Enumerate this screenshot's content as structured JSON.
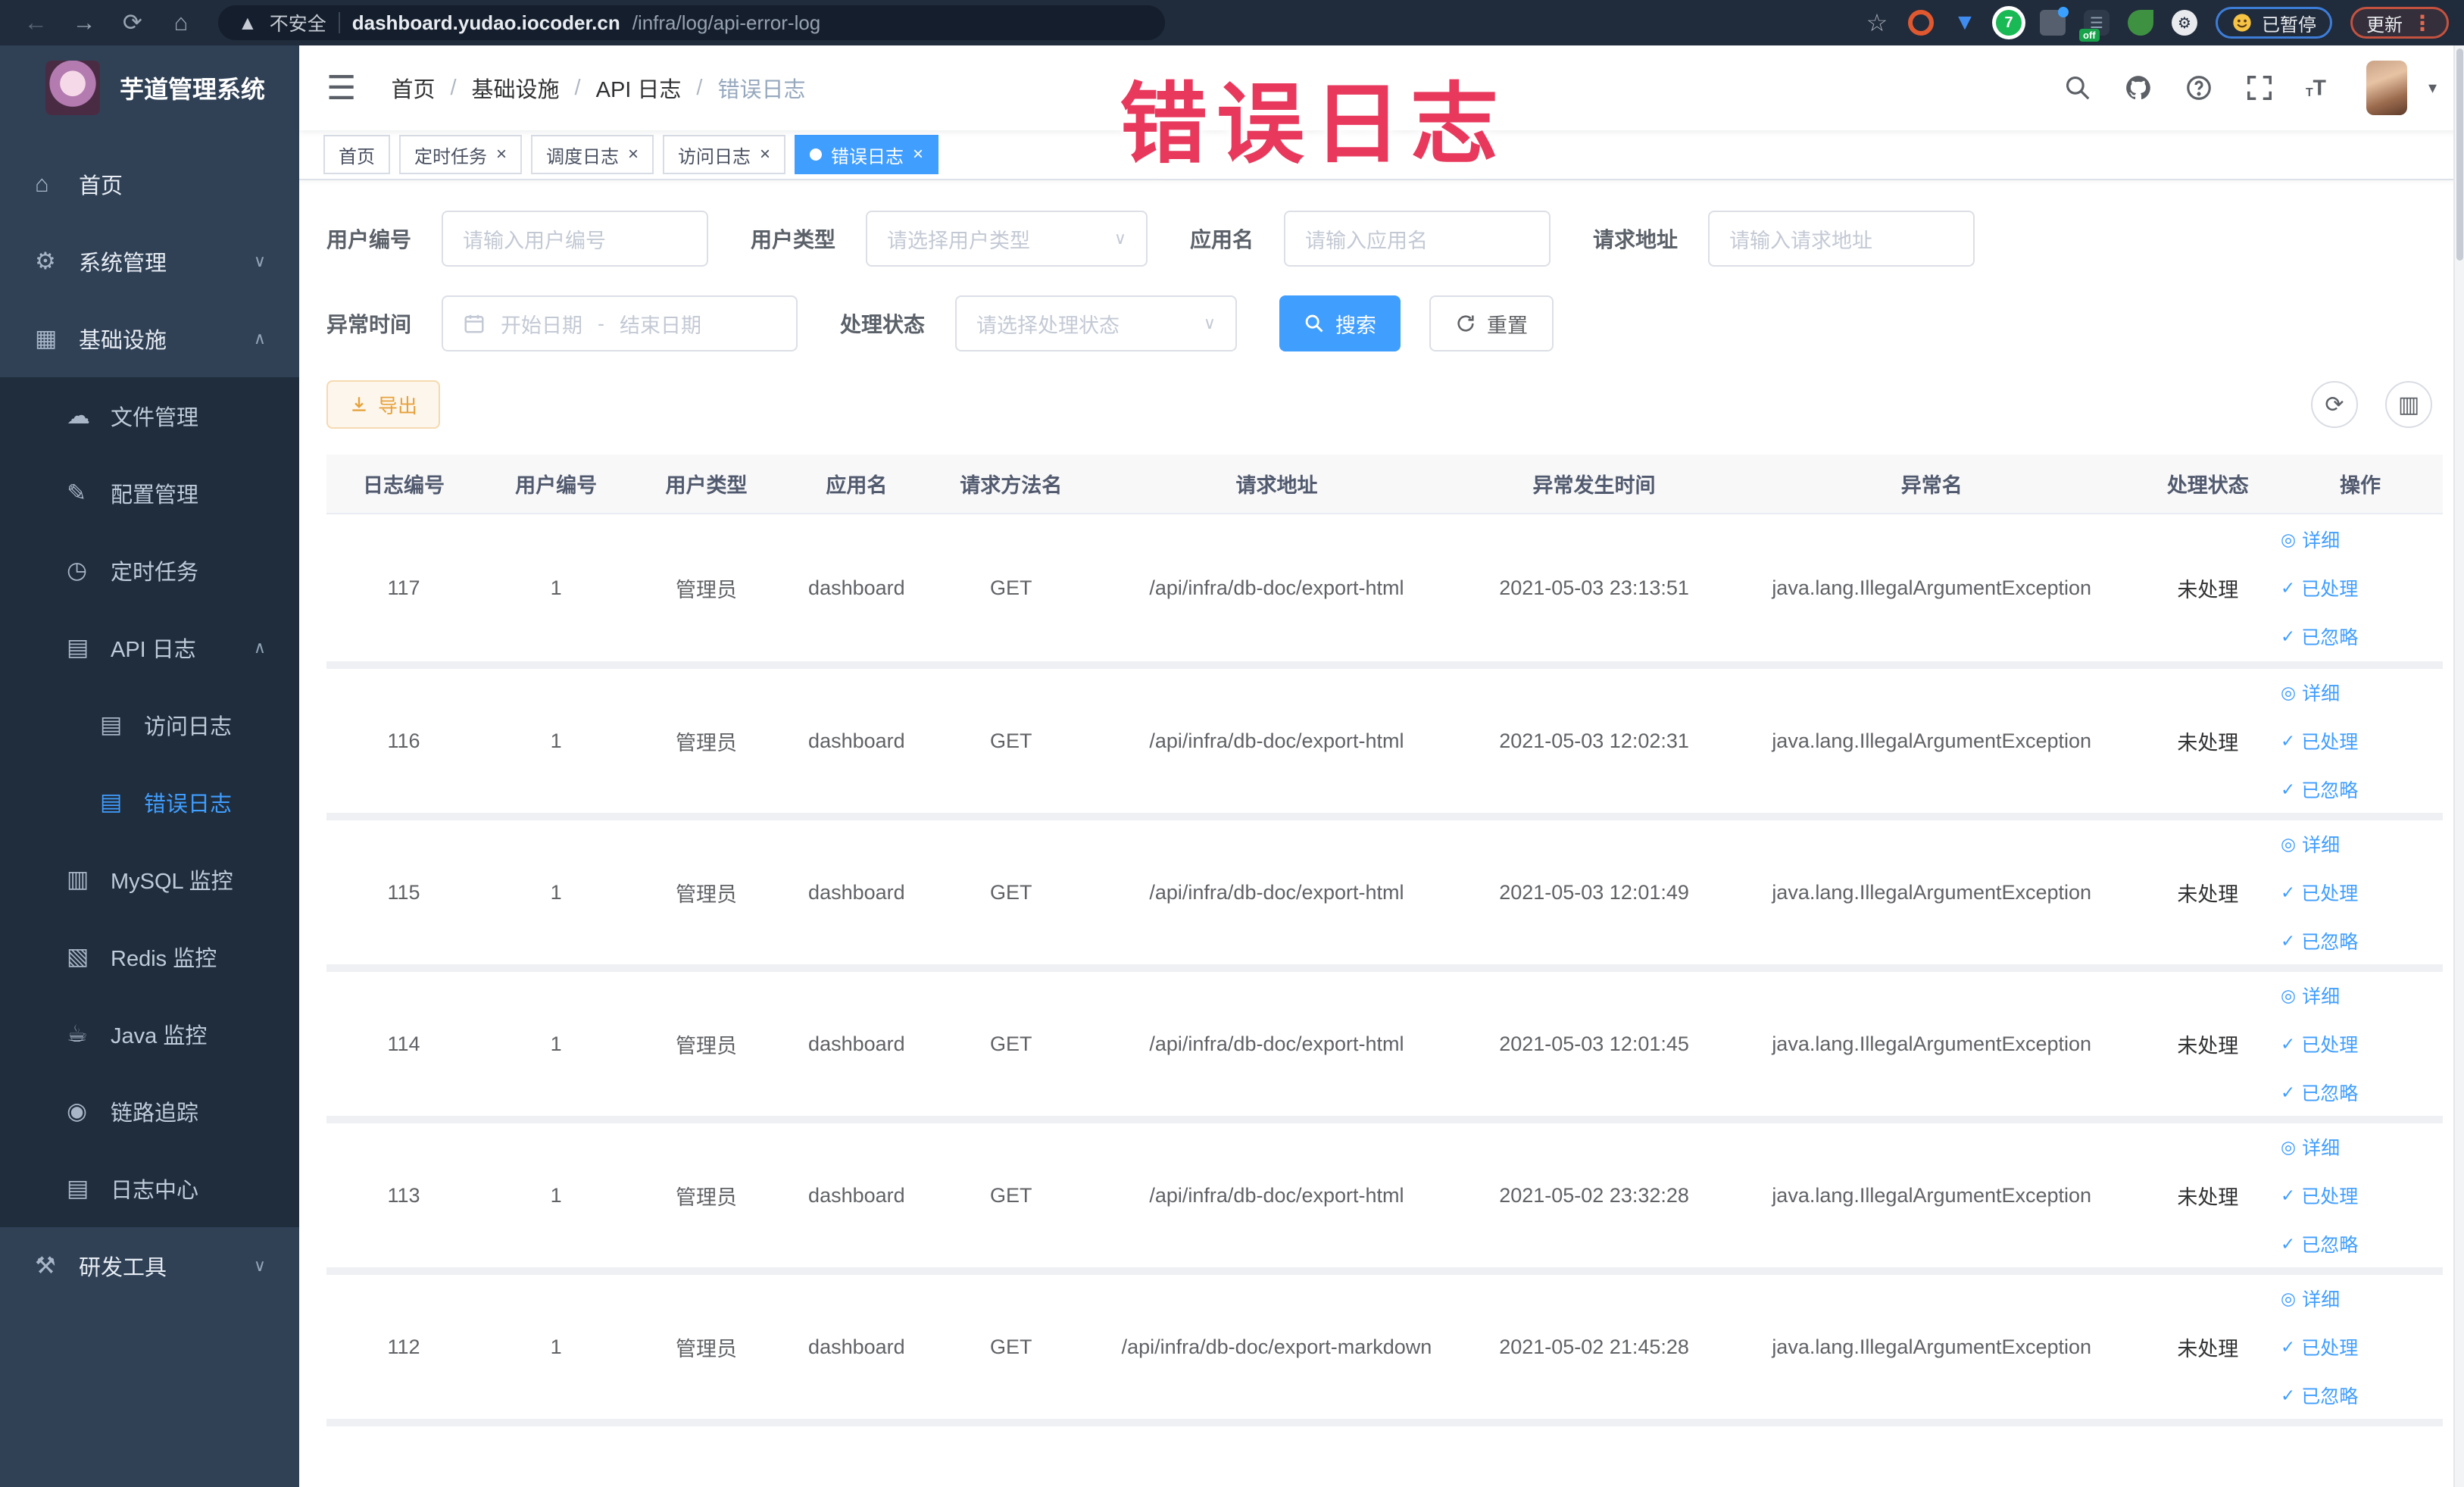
{
  "browser": {
    "security_label": "不安全",
    "url_host": "dashboard.yudao.iocoder.cn",
    "url_path": "/infra/log/api-error-log",
    "paused_badge": "已暂停",
    "update_button": "更新",
    "extension_badge_off": "off",
    "extension_badge_7": "7"
  },
  "watermark": "错误日志",
  "sidebar": {
    "title": "芋道管理系统",
    "items": [
      {
        "label": "首页",
        "level": 1,
        "icon": "home",
        "arrow": null,
        "active": false
      },
      {
        "label": "系统管理",
        "level": 1,
        "icon": "gear",
        "arrow": "down",
        "active": false
      },
      {
        "label": "基础设施",
        "level": 1,
        "icon": "infra",
        "arrow": "up",
        "active": false
      },
      {
        "label": "文件管理",
        "level": 2,
        "icon": "file",
        "arrow": null,
        "active": false
      },
      {
        "label": "配置管理",
        "level": 2,
        "icon": "edit",
        "arrow": null,
        "active": false
      },
      {
        "label": "定时任务",
        "level": 2,
        "icon": "timer",
        "arrow": null,
        "active": false
      },
      {
        "label": "API 日志",
        "level": 2,
        "icon": "log",
        "arrow": "up",
        "active": false
      },
      {
        "label": "访问日志",
        "level": 3,
        "icon": "log",
        "arrow": null,
        "active": false
      },
      {
        "label": "错误日志",
        "level": 3,
        "icon": "log",
        "arrow": null,
        "active": true
      },
      {
        "label": "MySQL 监控",
        "level": 2,
        "icon": "mysql",
        "arrow": null,
        "active": false
      },
      {
        "label": "Redis 监控",
        "level": 2,
        "icon": "redis",
        "arrow": null,
        "active": false
      },
      {
        "label": "Java 监控",
        "level": 2,
        "icon": "java",
        "arrow": null,
        "active": false
      },
      {
        "label": "链路追踪",
        "level": 2,
        "icon": "trace",
        "arrow": null,
        "active": false
      },
      {
        "label": "日志中心",
        "level": 2,
        "icon": "logcenter",
        "arrow": null,
        "active": false
      },
      {
        "label": "研发工具",
        "level": 1,
        "icon": "tool",
        "arrow": "down",
        "active": false
      }
    ]
  },
  "breadcrumb": [
    "首页",
    "基础设施",
    "API 日志",
    "错误日志"
  ],
  "tabs": [
    {
      "label": "首页",
      "closable": false,
      "active": false
    },
    {
      "label": "定时任务",
      "closable": true,
      "active": false
    },
    {
      "label": "调度日志",
      "closable": true,
      "active": false
    },
    {
      "label": "访问日志",
      "closable": true,
      "active": false
    },
    {
      "label": "错误日志",
      "closable": true,
      "active": true
    }
  ],
  "filters": {
    "user_id": {
      "label": "用户编号",
      "placeholder": "请输入用户编号"
    },
    "user_type": {
      "label": "用户类型",
      "placeholder": "请选择用户类型"
    },
    "app_name": {
      "label": "应用名",
      "placeholder": "请输入应用名"
    },
    "request_url": {
      "label": "请求地址",
      "placeholder": "请输入请求地址"
    },
    "exception_time": {
      "label": "异常时间",
      "start_placeholder": "开始日期",
      "separator": "-",
      "end_placeholder": "结束日期"
    },
    "process_status": {
      "label": "处理状态",
      "placeholder": "请选择处理状态"
    },
    "search_button": "搜索",
    "reset_button": "重置"
  },
  "toolbar": {
    "export_button": "导出"
  },
  "table": {
    "headers": [
      "日志编号",
      "用户编号",
      "用户类型",
      "应用名",
      "请求方法名",
      "请求地址",
      "异常发生时间",
      "异常名",
      "处理状态",
      "操作"
    ],
    "actions": [
      {
        "icon": "eye",
        "label": "详细"
      },
      {
        "icon": "check",
        "label": "已处理"
      },
      {
        "icon": "check",
        "label": "已忽略"
      }
    ],
    "rows": [
      {
        "id": "117",
        "user_id": "1",
        "user_type": "管理员",
        "app_name": "dashboard",
        "method": "GET",
        "url": "/api/infra/db-doc/export-html",
        "time": "2021-05-03 23:13:51",
        "exception": "java.lang.IllegalArgumentException",
        "status": "未处理"
      },
      {
        "id": "116",
        "user_id": "1",
        "user_type": "管理员",
        "app_name": "dashboard",
        "method": "GET",
        "url": "/api/infra/db-doc/export-html",
        "time": "2021-05-03 12:02:31",
        "exception": "java.lang.IllegalArgumentException",
        "status": "未处理"
      },
      {
        "id": "115",
        "user_id": "1",
        "user_type": "管理员",
        "app_name": "dashboard",
        "method": "GET",
        "url": "/api/infra/db-doc/export-html",
        "time": "2021-05-03 12:01:49",
        "exception": "java.lang.IllegalArgumentException",
        "status": "未处理"
      },
      {
        "id": "114",
        "user_id": "1",
        "user_type": "管理员",
        "app_name": "dashboard",
        "method": "GET",
        "url": "/api/infra/db-doc/export-html",
        "time": "2021-05-03 12:01:45",
        "exception": "java.lang.IllegalArgumentException",
        "status": "未处理"
      },
      {
        "id": "113",
        "user_id": "1",
        "user_type": "管理员",
        "app_name": "dashboard",
        "method": "GET",
        "url": "/api/infra/db-doc/export-html",
        "time": "2021-05-02 23:32:28",
        "exception": "java.lang.IllegalArgumentException",
        "status": "未处理"
      },
      {
        "id": "112",
        "user_id": "1",
        "user_type": "管理员",
        "app_name": "dashboard",
        "method": "GET",
        "url": "/api/infra/db-doc/export-markdown",
        "time": "2021-05-02 21:45:28",
        "exception": "java.lang.IllegalArgumentException",
        "status": "未处理"
      }
    ]
  },
  "colors": {
    "accent": "#409eff",
    "sidebar_bg": "#304156",
    "submenu_bg": "#1f2d3d",
    "watermark": "#e8395c",
    "warning": "#e6a23c"
  }
}
